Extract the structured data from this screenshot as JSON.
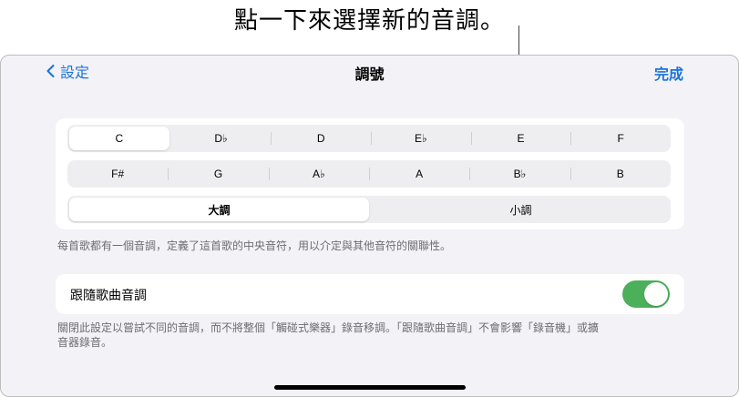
{
  "callout": {
    "text": "點一下來選擇新的音調。"
  },
  "nav": {
    "back_label": "設定",
    "title": "調號",
    "done_label": "完成"
  },
  "key_selector": {
    "row1": [
      "C",
      "D♭",
      "D",
      "E♭",
      "E",
      "F"
    ],
    "row2": [
      "F#",
      "G",
      "A♭",
      "A",
      "B♭",
      "B"
    ],
    "selected_key": "C"
  },
  "mode_selector": {
    "options": [
      "大調",
      "小調"
    ],
    "selected": "大調"
  },
  "key_note": "每首歌都有一個音調，定義了這首歌的中央音符，用以介定與其他音符的關聯性。",
  "follow_song_key": {
    "label": "跟隨歌曲音調",
    "enabled": true
  },
  "follow_note_line1": "關閉此設定以嘗試不同的音調，而不將整個「觸碰式樂器」錄音移調。「跟隨歌曲音調」不會影響「錄音機」或擴",
  "follow_note_line2": "音器錄音。",
  "colors": {
    "accent": "#1a73d9",
    "toggle_on": "#4cb05a",
    "background": "#f2f2f7"
  }
}
